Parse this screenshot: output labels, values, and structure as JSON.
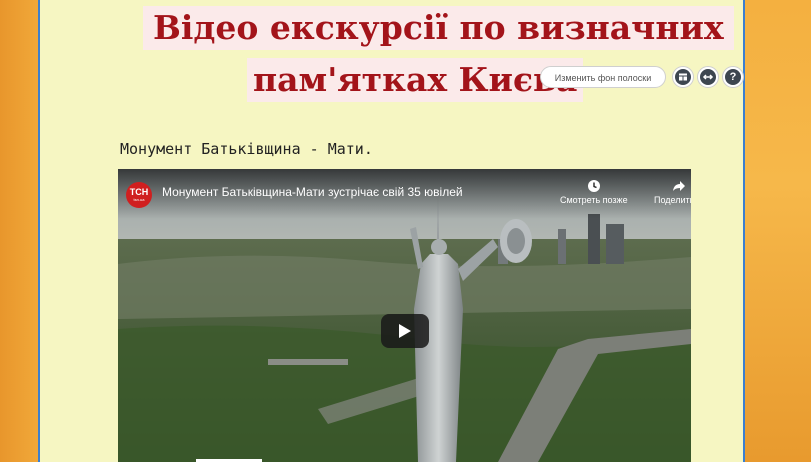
{
  "title": {
    "line1": "Відео екскурсії по визначних",
    "line2": "пам'ятках Києва"
  },
  "toolbar": {
    "change_bg_label": "Изменить фон полоски",
    "layout_icon": "layout-icon",
    "resize_icon": "horizontal-arrows-icon",
    "help_icon": "help-icon",
    "help_glyph": "?"
  },
  "caption": "Монумент Батьківщина -  Мати.",
  "video": {
    "channel_logo": "ТСН",
    "channel_sub": "tsn.ua",
    "title": "Монумент Батьківщина-Мати зустрічає свій 35 ювілей",
    "watch_later": "Смотреть позже",
    "share": "Поделиться"
  },
  "colors": {
    "title_red": "#a3141a",
    "title_bg": "#fbeaea",
    "page_bg": "#f6f6c2",
    "border_blue": "#3a7fd0"
  }
}
